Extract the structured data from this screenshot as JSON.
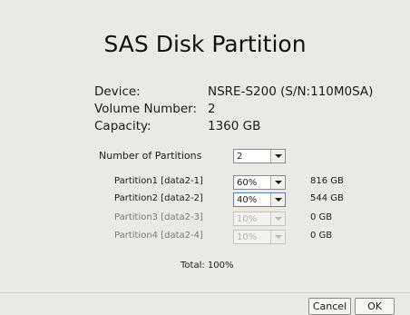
{
  "dialog": {
    "title": "SAS Disk Partition"
  },
  "info": {
    "device_label": "Device:",
    "device_value": "NSRE-S200 (S/N:110M0SA)",
    "volume_label": "Volume Number:",
    "volume_value": "2",
    "capacity_label": "Capacity:",
    "capacity_value": "1360 GB"
  },
  "partitions": {
    "count_label": "Number of Partitions",
    "count_value": "2",
    "rows": [
      {
        "label": "Partition1 [data2-1]",
        "percent": "60%",
        "size": "816 GB",
        "enabled": true
      },
      {
        "label": "Partition2 [data2-2]",
        "percent": "40%",
        "size": "544 GB",
        "enabled": true
      },
      {
        "label": "Partition3 [data2-3]",
        "percent": "10%",
        "size": "0 GB",
        "enabled": false
      },
      {
        "label": "Partition4 [data2-4]",
        "percent": "10%",
        "size": "0 GB",
        "enabled": false
      }
    ],
    "total": "Total: 100%"
  },
  "buttons": {
    "cancel": "Cancel",
    "ok": "OK"
  }
}
